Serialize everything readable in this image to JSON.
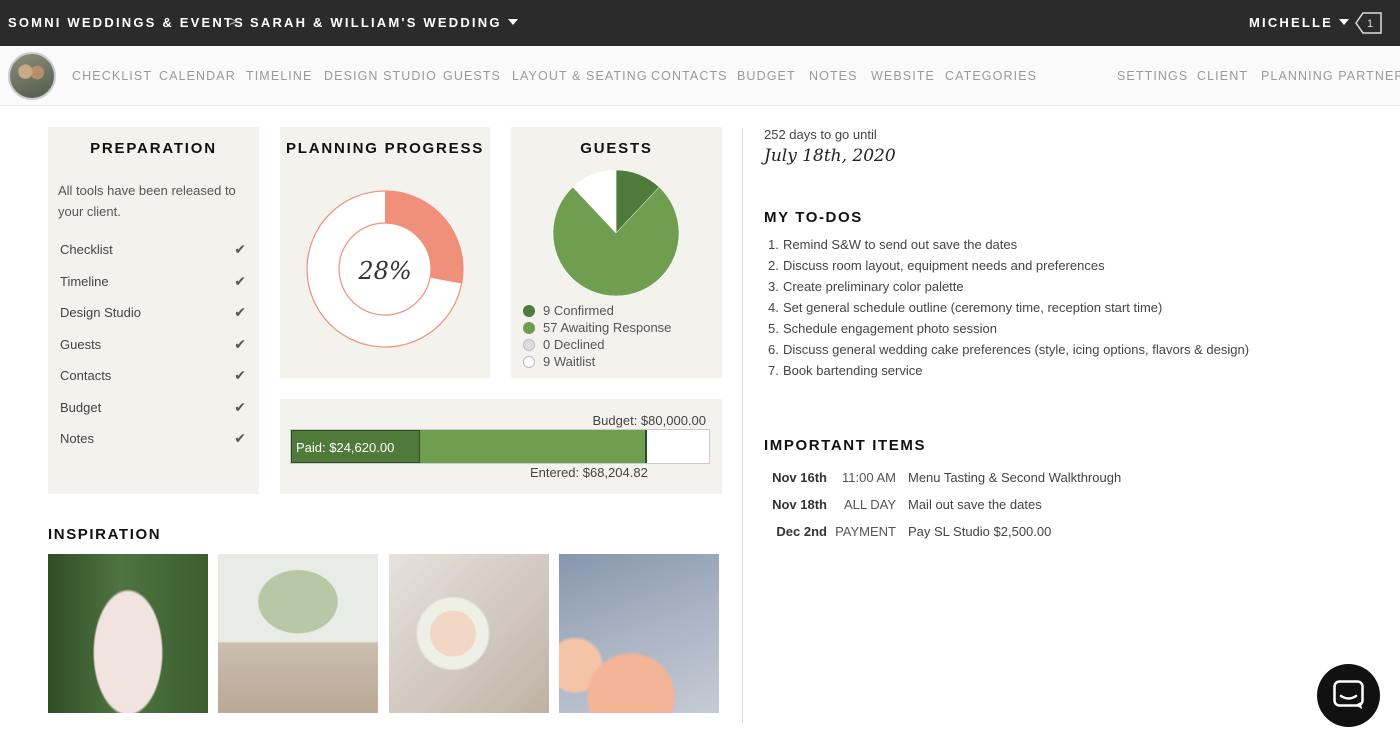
{
  "header": {
    "company": "SOMNI WEDDINGS & EVENTS",
    "separator": ">",
    "event": "SARAH & WILLIAM'S WEDDING",
    "user": "MICHELLE",
    "notifications": "1"
  },
  "nav": {
    "left": [
      "CHECKLIST",
      "CALENDAR",
      "TIMELINE",
      "DESIGN STUDIO",
      "GUESTS",
      "LAYOUT & SEATING",
      "CONTACTS",
      "BUDGET",
      "NOTES",
      "WEBSITE",
      "CATEGORIES"
    ],
    "right": [
      "SETTINGS",
      "CLIENT",
      "PLANNING PARTNERS"
    ]
  },
  "preparation": {
    "title": "PREPARATION",
    "description": "All tools have been released to your client.",
    "items": [
      "Checklist",
      "Timeline",
      "Design Studio",
      "Guests",
      "Contacts",
      "Budget",
      "Notes"
    ],
    "check_icon": "check-icon"
  },
  "planning_progress": {
    "title": "PLANNING PROGRESS",
    "percent_label": "28%",
    "percent_value": 0.28,
    "color": "#f0907a"
  },
  "guests": {
    "title": "GUESTS",
    "legend": [
      {
        "label": "9 Confirmed",
        "color": "#4f7a3a"
      },
      {
        "label": "57 Awaiting Response",
        "color": "#6f9e50"
      },
      {
        "label": "0 Declined",
        "color": "#dddddd"
      },
      {
        "label": "9 Waitlist",
        "color": "#ffffff"
      }
    ]
  },
  "chart_data": {
    "type": "pie",
    "title": "GUESTS",
    "categories": [
      "Confirmed",
      "Awaiting Response",
      "Declined",
      "Waitlist"
    ],
    "values": [
      9,
      57,
      0,
      9
    ],
    "colors": [
      "#4f7a3a",
      "#6f9e50",
      "#dddddd",
      "#ffffff"
    ]
  },
  "budget": {
    "budget_label": "Budget: $80,000.00",
    "paid_label": "Paid: $24,620.00",
    "entered_label": "Entered: $68,204.82",
    "budget_total": 80000,
    "paid": 24620,
    "entered": 68204.82
  },
  "inspiration": {
    "title": "INSPIRATION"
  },
  "countdown": {
    "days": "252 days to go until",
    "date": "July 18th, 2020"
  },
  "todos": {
    "title": "MY TO-DOS",
    "items": [
      {
        "num": "1.",
        "text": "Remind S&W to send out save the dates"
      },
      {
        "num": "2.",
        "text": "Discuss room layout, equipment needs and preferences"
      },
      {
        "num": "3.",
        "text": "Create preliminary color palette"
      },
      {
        "num": "4.",
        "text": "Set general schedule outline (ceremony time, reception start time)"
      },
      {
        "num": "5.",
        "text": "Schedule engagement photo session"
      },
      {
        "num": "6.",
        "text": "Discuss general wedding cake preferences (style, icing options, flavors & design)"
      },
      {
        "num": "7.",
        "text": "Book bartending service"
      }
    ]
  },
  "important": {
    "title": "IMPORTANT ITEMS",
    "items": [
      {
        "date": "Nov 16th",
        "time": "11:00 AM",
        "desc": "Menu Tasting & Second Walkthrough"
      },
      {
        "date": "Nov 18th",
        "time": "ALL DAY",
        "desc": "Mail out save the dates"
      },
      {
        "date": "Dec 2nd",
        "time": "PAYMENT",
        "desc": "Pay SL Studio $2,500.00"
      }
    ]
  }
}
